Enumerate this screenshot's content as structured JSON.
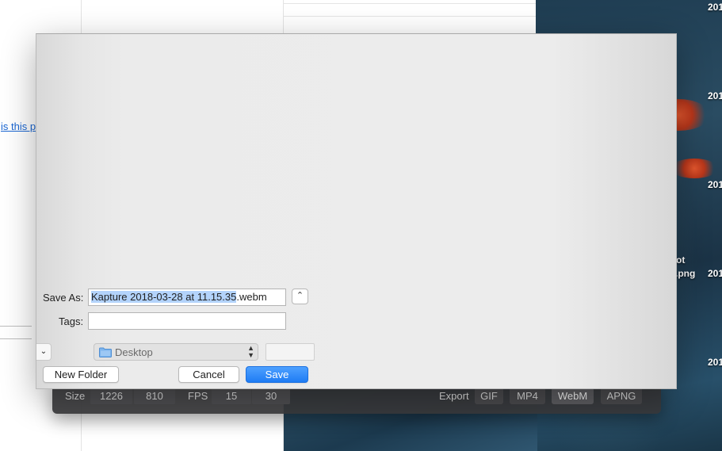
{
  "desktop": {
    "labels": [
      "201",
      "201",
      "201",
      "201",
      "201"
    ],
    "file_label_line1": "ot",
    "file_label_line2": ".png"
  },
  "browser": {
    "link_fragment": "is this p"
  },
  "kapture": {
    "size_label": "Size",
    "width": "1226",
    "height": "810",
    "fps_label": "FPS",
    "fps_options": [
      "15",
      "30"
    ],
    "export_label": "Export",
    "formats": [
      "GIF",
      "MP4",
      "WebM",
      "APNG"
    ],
    "selected_format": "WebM"
  },
  "dialog": {
    "save_as_label": "Save As:",
    "filename_selected": "Kapture 2018-03-28 at 11.15.35",
    "filename_ext": ".webm",
    "tags_label": "Tags:",
    "tags_value": "",
    "location": "Desktop",
    "new_folder_label": "New Folder",
    "cancel_label": "Cancel",
    "save_label": "Save",
    "expand_glyph": "⌃",
    "side_glyph": "⌄"
  },
  "colors": {
    "accent": "#1f7cf4",
    "selection": "#b3d3fb",
    "link": "#1a66d2"
  },
  "icons": {
    "folder": "folder-icon",
    "expand": "chevron-up-icon",
    "popup_arrows": "up-down-arrows-icon"
  }
}
